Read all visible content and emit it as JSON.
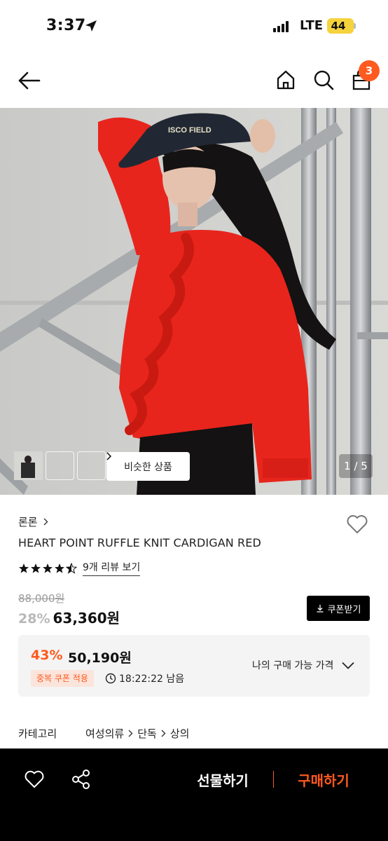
{
  "status_bar": {
    "time": "3:37",
    "network": "LTE",
    "battery": "44"
  },
  "header": {
    "cart_count": "3"
  },
  "gallery": {
    "similar_label": "비슷한 상품",
    "counter": "1 / 5"
  },
  "product": {
    "brand": "론론",
    "name": "HEART POINT RUFFLE KNIT CARDIGAN RED",
    "rating": 4.5,
    "review_link": "9개 리뷰 보기",
    "original_price": "88,000원",
    "discount": "28%",
    "price": "63,360원",
    "coupon_label": "쿠폰받기"
  },
  "best_price": {
    "discount": "43%",
    "price": "50,190원",
    "coupon_badge": "중복 쿠폰 적용",
    "timer": "18:22:22 남음",
    "my_price_label": "나의 구매 가능 가격"
  },
  "category": {
    "label": "카테고리",
    "path": [
      "여성의류",
      "단독",
      "상의"
    ]
  },
  "bottom_bar": {
    "gift_label": "선물하기",
    "buy_label": "구매하기"
  },
  "colors": {
    "accent": "#ff5a1f",
    "sweater": "#e8251c",
    "dark": "#000000"
  }
}
